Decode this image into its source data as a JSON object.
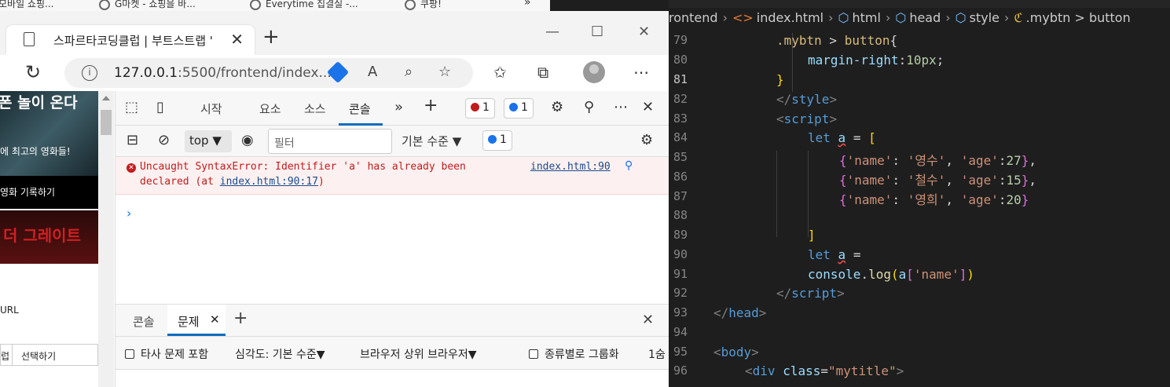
{
  "bookmarks": [
    {
      "label": "모바일 쇼핑..."
    },
    {
      "label": "G마켓 - 쇼핑을 바..."
    },
    {
      "label": "Everytime 집결실 -..."
    },
    {
      "label": "쿠팡!"
    }
  ],
  "bookmarks_more": "»",
  "tab": {
    "title": "스파르타코딩클럽 | 부트스트랩 '",
    "close": "✕"
  },
  "new_tab": "+",
  "window": {
    "minimize": "—",
    "maximize": "☐",
    "close": "✕"
  },
  "address": {
    "host": "127.0.0.1",
    "rest": ":5500/frontend/index...."
  },
  "page": {
    "banner_top": "폰 놀이 온다",
    "banner_mid": "에 최고의 영화들!",
    "record": "영화 기록하기",
    "poster": "더 그레이트",
    "url_label": "URL",
    "sel_a": "럽",
    "sel_b": "선택하기"
  },
  "devtools": {
    "tabs": [
      "시작",
      "요소",
      "소스",
      "콘솔"
    ],
    "more": "»",
    "add": "+",
    "error_count": "1",
    "info_count": "1",
    "close": "✕",
    "context": "top",
    "filter_placeholder": "필터",
    "levels": "기본 수준",
    "levels_count": "1",
    "error": {
      "line1": "Uncaught SyntaxError: Identifier 'a' has already been",
      "line2_pre": "declared (at ",
      "line2_link": "index.html:90:17",
      "line2_post": ")",
      "source": "index.html:90"
    },
    "prompt": "›",
    "drawer_tabs": [
      "콘솔",
      "문제"
    ],
    "drawer_add": "+",
    "drawer_close": "✕",
    "issues": {
      "third_party": "타사 문제 포함",
      "severity": "심각도: 기본 수준",
      "browser": "브라우저 상위 브라우저",
      "group": "종류별로 그룹화",
      "count": "1숨"
    }
  },
  "editor": {
    "breadcrumb": [
      "rontend",
      "index.html",
      "html",
      "head",
      "style",
      ".mybtn > button"
    ],
    "line_numbers": [
      "79",
      "80",
      "81",
      "82",
      "83",
      "84",
      "85",
      "86",
      "87",
      "88",
      "89",
      "90",
      "91",
      "92",
      "93",
      "94",
      "95",
      "96"
    ],
    "current_line": "81"
  },
  "colors": {
    "accent": "#0f6cbd",
    "error": "#c11c1c",
    "editor_bg": "#1e1e1e"
  }
}
